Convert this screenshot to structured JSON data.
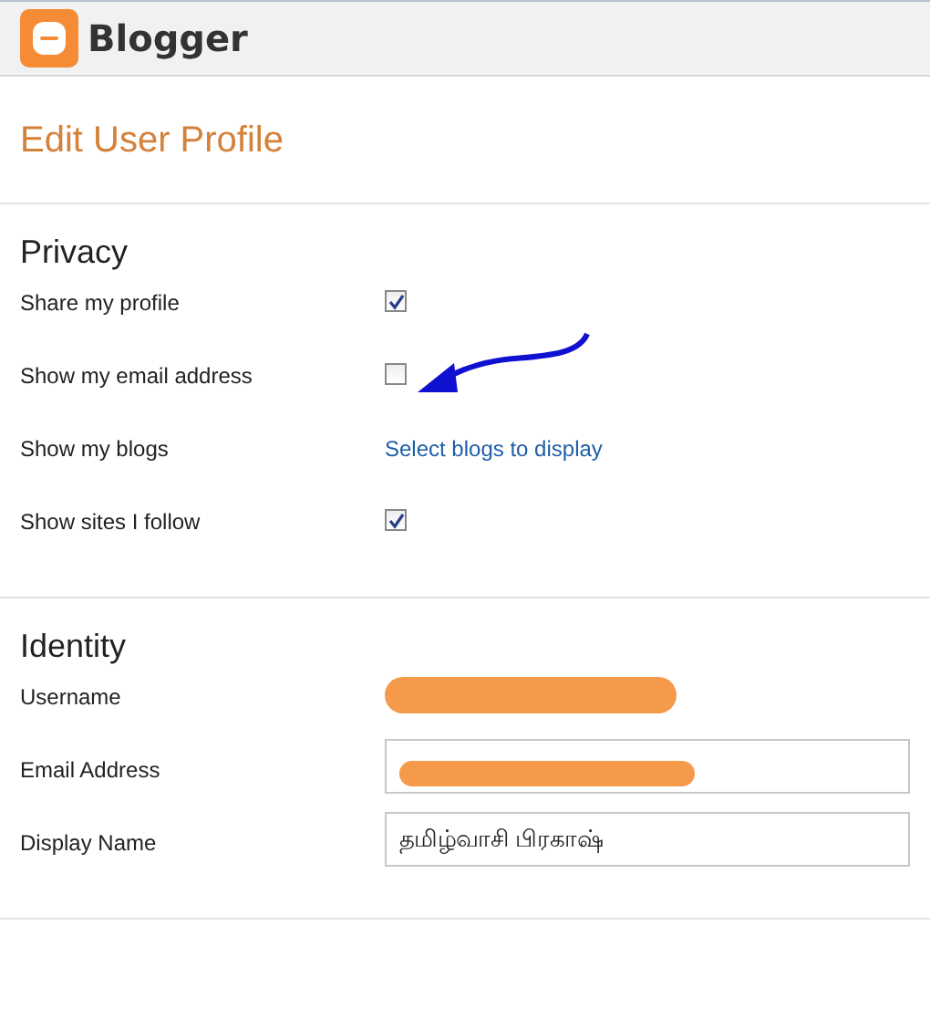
{
  "app": {
    "name": "Blogger"
  },
  "page_title": "Edit User Profile",
  "sections": [
    {
      "title": "Privacy",
      "rows": [
        {
          "kind": "checkbox",
          "label": "Share my profile",
          "checked": true,
          "annotated": false
        },
        {
          "kind": "checkbox",
          "label": "Show my email address",
          "checked": false,
          "annotated": true
        },
        {
          "kind": "link",
          "label": "Show my blogs",
          "link": "Select blogs to display"
        },
        {
          "kind": "checkbox",
          "label": "Show sites I follow",
          "checked": true,
          "annotated": false
        }
      ]
    },
    {
      "title": "Identity",
      "rows": [
        {
          "kind": "redacted",
          "label": "Username"
        },
        {
          "kind": "redacted-input",
          "label": "Email Address"
        },
        {
          "kind": "input",
          "label": "Display Name",
          "value": "தமிழ்வாசி பிரகாஷ்"
        }
      ]
    }
  ]
}
